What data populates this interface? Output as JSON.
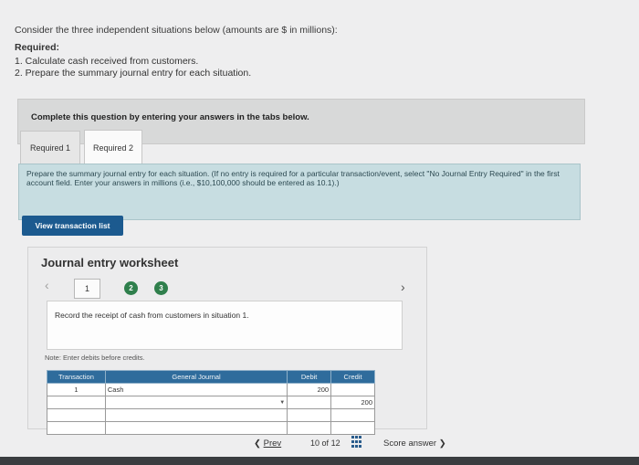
{
  "intro": "Consider the three independent situations below (amounts are $ in millions):",
  "required": {
    "heading": "Required:",
    "items": [
      "1. Calculate cash received from customers.",
      "2. Prepare the summary journal entry for each situation."
    ]
  },
  "banner": "Complete this question by entering your answers in the tabs below.",
  "tabs": [
    {
      "label": "Required 1",
      "active": false
    },
    {
      "label": "Required 2",
      "active": true
    }
  ],
  "instruction": "Prepare the summary journal entry for each situation. (If no entry is required for a particular transaction/event, select \"No Journal Entry Required\" in the first account field. Enter your answers in millions (i.e., $10,100,000 should be entered as 10.1).)",
  "view_button": "View transaction list",
  "worksheet": {
    "title": "Journal entry worksheet",
    "steps": [
      "1",
      "2",
      "3"
    ],
    "description": "Record the receipt of cash from customers in situation 1.",
    "note": "Note: Enter debits before credits.",
    "columns": [
      "Transaction",
      "General Journal",
      "Debit",
      "Credit"
    ],
    "rows": [
      {
        "transaction": "1",
        "account": "Cash",
        "debit": "200",
        "credit": ""
      },
      {
        "transaction": "",
        "account": "",
        "debit": "",
        "credit": "200"
      },
      {
        "transaction": "",
        "account": "",
        "debit": "",
        "credit": ""
      },
      {
        "transaction": "",
        "account": "",
        "debit": "",
        "credit": ""
      }
    ]
  },
  "footer": {
    "prev": "Prev",
    "page": "10",
    "of": "of",
    "total": "12",
    "score": "Score answer"
  },
  "colors": {
    "header_blue": "#2f6c9c",
    "button_blue": "#1c5a8f",
    "step_green": "#2f7f4c",
    "instruction_bg": "#c7dde1"
  }
}
